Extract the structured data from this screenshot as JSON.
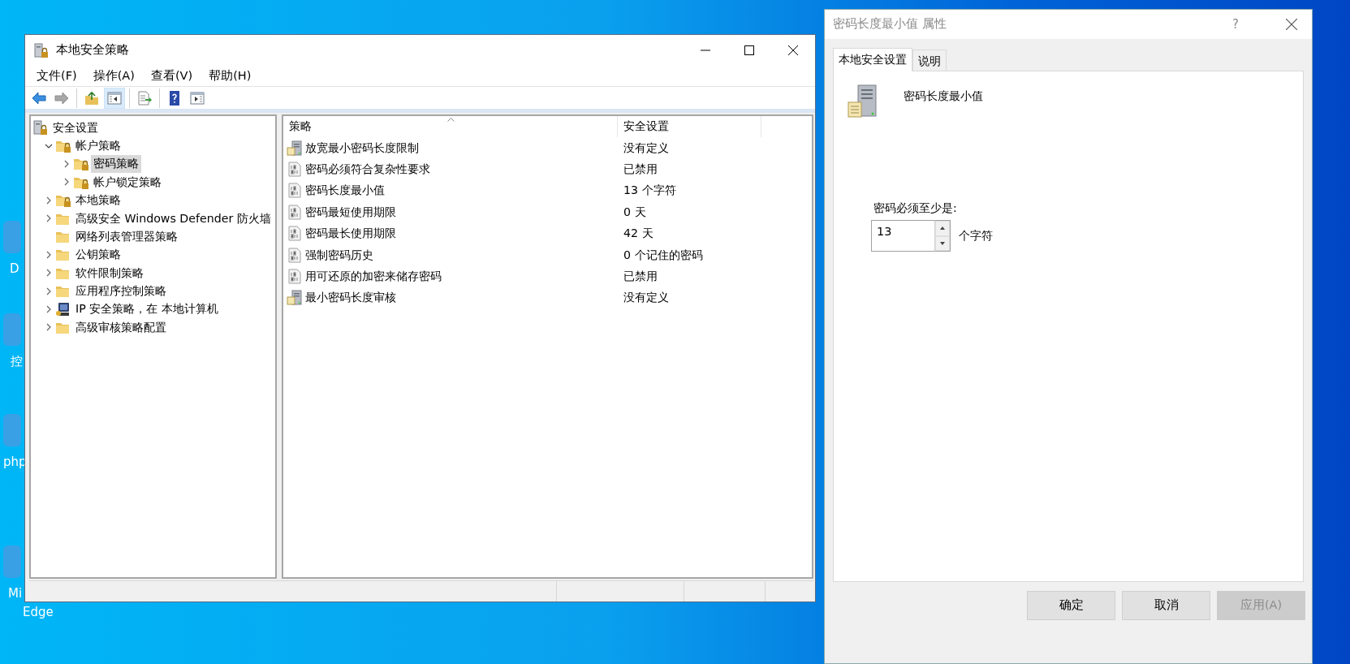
{
  "desktop": {
    "icons": [
      {
        "lines": [
          "D"
        ]
      },
      {
        "lines": [
          "控"
        ]
      },
      {
        "lines": [
          "php"
        ]
      },
      {
        "lines": [
          "Mi",
          "Edge"
        ]
      }
    ]
  },
  "main_window": {
    "title": "本地安全策略",
    "menu": [
      "文件(F)",
      "操作(A)",
      "查看(V)",
      "帮助(H)"
    ],
    "toolbar": [
      {
        "kind": "back",
        "disabled": false,
        "selected": false
      },
      {
        "kind": "forward",
        "disabled": true,
        "selected": false
      },
      {
        "kind": "sep"
      },
      {
        "kind": "up",
        "disabled": false,
        "selected": false
      },
      {
        "kind": "tree",
        "disabled": false,
        "selected": true
      },
      {
        "kind": "sep"
      },
      {
        "kind": "export",
        "disabled": false,
        "selected": false
      },
      {
        "kind": "sep"
      },
      {
        "kind": "help",
        "disabled": false,
        "selected": false
      },
      {
        "kind": "pane",
        "disabled": false,
        "selected": false
      }
    ],
    "tree": [
      {
        "label": "安全设置",
        "kind": "root",
        "selected": false,
        "children": [
          {
            "label": "帐户策略",
            "kind": "lockfolder",
            "expanded": true,
            "selected": false,
            "children": [
              {
                "label": "密码策略",
                "kind": "lockfolder",
                "expanded": false,
                "selected": true,
                "expandable": true
              },
              {
                "label": "帐户锁定策略",
                "kind": "lockfolder",
                "expanded": false,
                "selected": false,
                "expandable": true
              }
            ]
          },
          {
            "label": "本地策略",
            "kind": "lockfolder",
            "expanded": false,
            "selected": false,
            "expandable": true
          },
          {
            "label": "高级安全 Windows Defender 防火墙",
            "kind": "folder",
            "expanded": false,
            "selected": false,
            "expandable": true
          },
          {
            "label": "网络列表管理器策略",
            "kind": "folder",
            "expanded": false,
            "selected": false,
            "expandable": false
          },
          {
            "label": "公钥策略",
            "kind": "folder",
            "expanded": false,
            "selected": false,
            "expandable": true
          },
          {
            "label": "软件限制策略",
            "kind": "folder",
            "expanded": false,
            "selected": false,
            "expandable": true
          },
          {
            "label": "应用程序控制策略",
            "kind": "folder",
            "expanded": false,
            "selected": false,
            "expandable": true
          },
          {
            "label": "IP 安全策略，在 本地计算机",
            "kind": "ip",
            "expanded": false,
            "selected": false,
            "expandable": true
          },
          {
            "label": "高级审核策略配置",
            "kind": "folder",
            "expanded": false,
            "selected": false,
            "expandable": true
          }
        ]
      }
    ],
    "table": {
      "columns": [
        "策略",
        "安全设置"
      ],
      "rows": [
        {
          "kind": "server",
          "policy": "放宽最小密码长度限制",
          "setting": "没有定义"
        },
        {
          "kind": "binary",
          "policy": "密码必须符合复杂性要求",
          "setting": "已禁用"
        },
        {
          "kind": "binary",
          "policy": "密码长度最小值",
          "setting": "13 个字符"
        },
        {
          "kind": "binary",
          "policy": "密码最短使用期限",
          "setting": "0 天"
        },
        {
          "kind": "binary",
          "policy": "密码最长使用期限",
          "setting": "42 天"
        },
        {
          "kind": "binary",
          "policy": "强制密码历史",
          "setting": "0 个记住的密码"
        },
        {
          "kind": "binary",
          "policy": "用可还原的加密来储存密码",
          "setting": "已禁用"
        },
        {
          "kind": "server",
          "policy": "最小密码长度审核",
          "setting": "没有定义"
        }
      ]
    }
  },
  "dialog": {
    "title": "密码长度最小值 属性",
    "help": "?",
    "tabs": [
      {
        "label": "本地安全设置",
        "selected": true
      },
      {
        "label": "说明",
        "selected": false
      }
    ],
    "policy_name": "密码长度最小值",
    "field_label": "密码必须至少是:",
    "value": "13",
    "unit": "个字符",
    "buttons": [
      {
        "label": "确定",
        "disabled": false
      },
      {
        "label": "取消",
        "disabled": false
      },
      {
        "label": "应用(A)",
        "disabled": true
      }
    ]
  }
}
